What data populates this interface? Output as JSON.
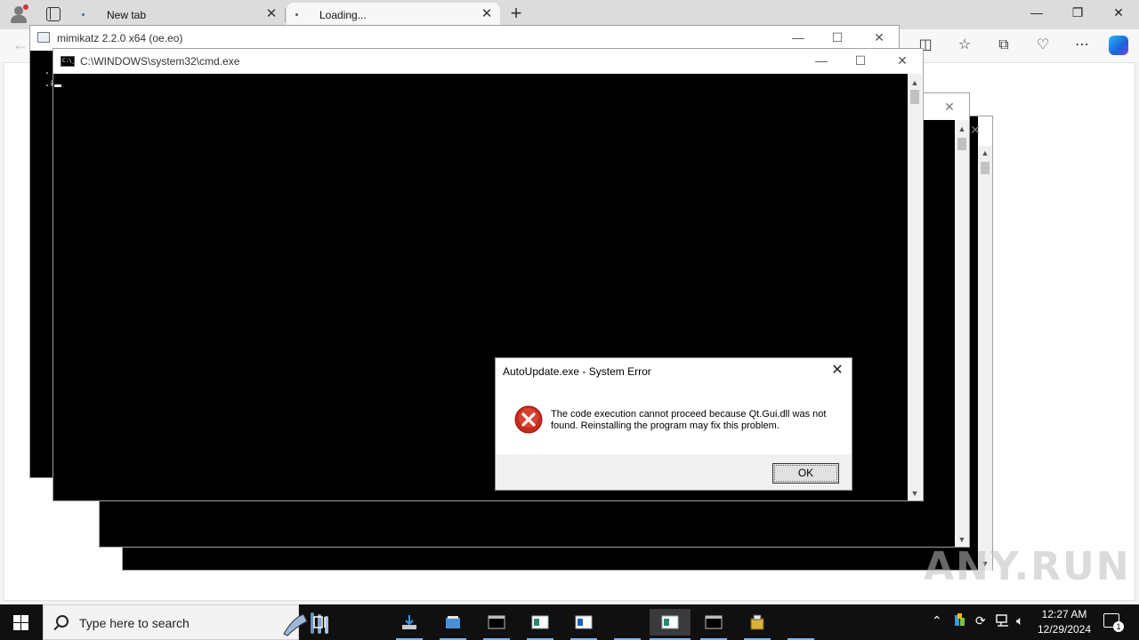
{
  "browser": {
    "tabs": [
      {
        "title": "New tab",
        "close": "✕"
      },
      {
        "title": "Loading...",
        "close": "✕"
      }
    ],
    "new_tab": "+",
    "window_controls": {
      "minimize": "—",
      "restore": "❐",
      "close": "✕"
    },
    "toolbar_icons": [
      "split-screen-icon",
      "favorites-icon",
      "collections-icon",
      "browser-essentials-icon",
      "more-icon",
      "copilot-icon"
    ]
  },
  "windows": {
    "mimikatz": {
      "title": "mimikatz 2.2.0 x64 (oe.eo)",
      "console_text": " .\n .#"
    },
    "cmd": {
      "title": "C:\\WINDOWS\\system32\\cmd.exe",
      "icon_text": "C:\\_"
    },
    "caption_controls": {
      "minimize": "—",
      "maximize": "☐",
      "close": "✕"
    }
  },
  "dialog": {
    "title": "AutoUpdate.exe - System Error",
    "message": "The code execution cannot proceed because Qt.Gui.dll was not found. Reinstalling the program may fix this problem.",
    "ok_label": "OK",
    "close": "✕",
    "icon": "error-icon",
    "colors": {
      "error": "#d13438"
    }
  },
  "watermark": "ANY.RUN",
  "taskbar": {
    "search_placeholder": "Type here to search",
    "clock_time": "12:27 AM",
    "clock_date": "12/29/2024",
    "notification_count": "1",
    "apps": [
      "task-view",
      "downloads",
      "explorer",
      "cmd",
      "app-window",
      "app-window-2",
      "app-window-active",
      "cmd-2",
      "installer"
    ],
    "accent": "#7ab6ff"
  }
}
